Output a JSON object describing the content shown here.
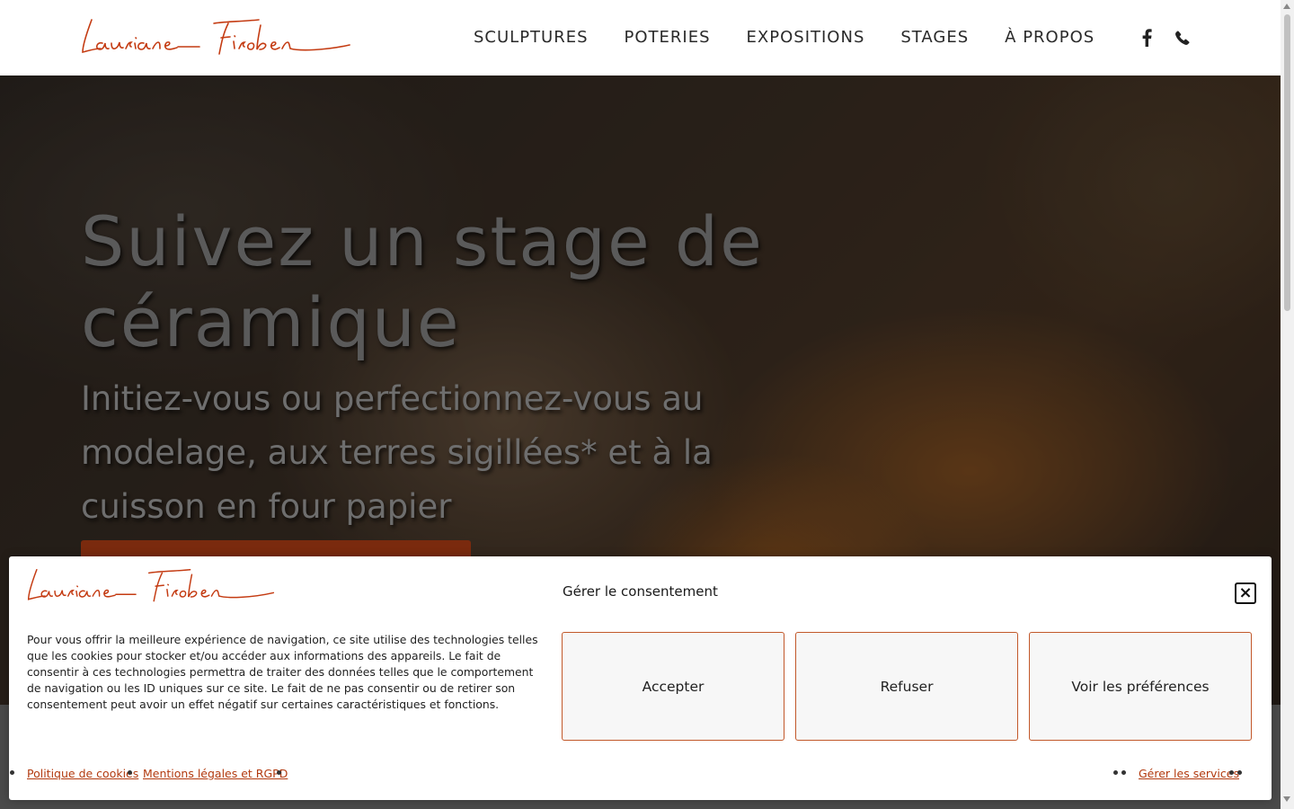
{
  "brand": {
    "logo_text": "Lauriane Firoben",
    "color": "#c43b12"
  },
  "nav": {
    "items": [
      {
        "label": "SCULPTURES"
      },
      {
        "label": "POTERIES"
      },
      {
        "label": "EXPOSITIONS"
      },
      {
        "label": "STAGES"
      },
      {
        "label": "À PROPOS"
      }
    ],
    "social": [
      {
        "icon": "facebook-icon"
      },
      {
        "icon": "phone-icon"
      }
    ]
  },
  "hero": {
    "title": "Suivez un stage de céramique",
    "subtitle": "Initiez-vous ou perfectionnez-vous au modelage, aux terres sigillées* et à la cuisson en four papier"
  },
  "consent": {
    "title": "Gérer le consentement",
    "text": "Pour vous offrir la meilleure expérience de navigation, ce site utilise des technologies telles que les cookies pour stocker et/ou accéder aux informations des appareils. Le fait de consentir à ces technologies permettra de traiter des données telles que le comportement de navigation ou les ID uniques sur ce site. Le fait de ne pas consentir ou de retirer son consentement peut avoir un effet négatif sur certaines caractéristiques et fonctions.",
    "buttons": {
      "accept": "Accepter",
      "deny": "Refuser",
      "preferences": "Voir les préférences"
    },
    "links": {
      "cookie_policy": "Politique de cookies",
      "legal": "Mentions légales et RGPD",
      "manage_services": "Gérer les services"
    },
    "accent": "#c2582a"
  }
}
